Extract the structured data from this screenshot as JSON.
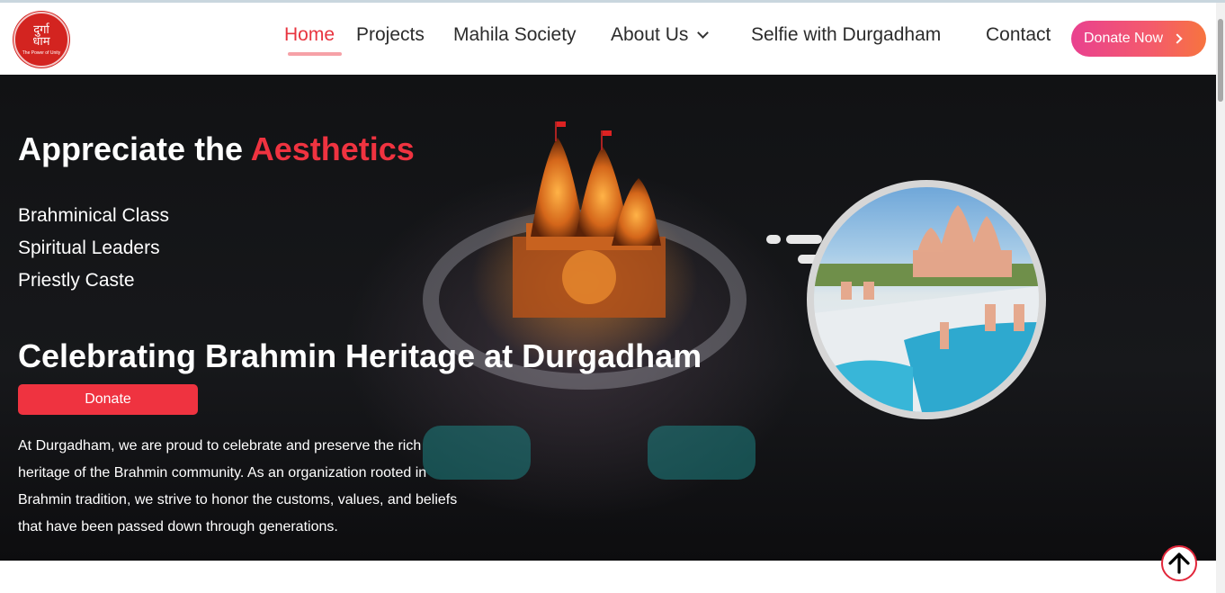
{
  "logo": {
    "line1": "दुर्गा",
    "line2": "धाम",
    "tagline": "The Power of Unity"
  },
  "nav": {
    "items": [
      {
        "label": "Home",
        "active": true
      },
      {
        "label": "Projects"
      },
      {
        "label": "Mahila Society"
      },
      {
        "label": "About Us",
        "has_dropdown": true
      },
      {
        "label": "Selfie with Durgadham"
      },
      {
        "label": "Contact"
      }
    ],
    "cta_label": "Donate Now"
  },
  "hero": {
    "title_prefix": "Appreciate the ",
    "title_accent": "Aesthetics",
    "list": [
      "Brahminical Class",
      "Spiritual Leaders",
      "Priestly Caste"
    ],
    "subtitle": "Celebrating Brahmin Heritage at Durgadham",
    "button_label": "Donate",
    "body": "At Durgadham, we are proud to celebrate and preserve the rich heritage of the Brahmin community. As an organization rooted in Brahmin tradition, we strive to honor the customs, values, and beliefs that have been passed down through generations."
  },
  "colors": {
    "accent": "#ef3340",
    "cta_gradient_start": "#e9418f",
    "cta_gradient_end": "#f7743f"
  },
  "icons": {
    "to_top": "arrow-up-icon",
    "dropdown": "chevron-down-icon",
    "cta": "chevron-right-icon"
  }
}
